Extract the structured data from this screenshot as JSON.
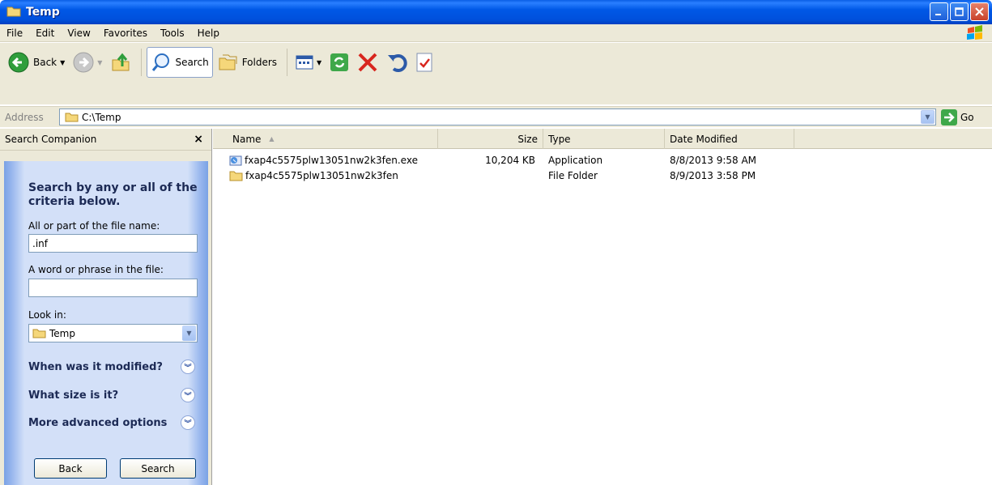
{
  "window": {
    "title": "Temp"
  },
  "menu": [
    "File",
    "Edit",
    "View",
    "Favorites",
    "Tools",
    "Help"
  ],
  "toolbar": {
    "back_label": "Back",
    "search_label": "Search",
    "folders_label": "Folders"
  },
  "address": {
    "label": "Address",
    "path": "C:\\Temp",
    "go_label": "Go"
  },
  "search_pane": {
    "title": "Search Companion",
    "close": "×",
    "heading": "Search by any or all of the criteria below.",
    "filename_label": "All or part of the file name:",
    "filename_value": ".inf",
    "phrase_label": "A word or phrase in the file:",
    "phrase_value": "",
    "lookin_label": "Look in:",
    "lookin_value": "Temp",
    "opt_modified": "When was it modified?",
    "opt_size": "What size is it?",
    "opt_advanced": "More advanced options",
    "back_button": "Back",
    "search_button": "Search"
  },
  "columns": {
    "name": "Name",
    "size": "Size",
    "type": "Type",
    "date": "Date Modified"
  },
  "files": [
    {
      "name": "fxap4c5575plw13051nw2k3fen.exe",
      "size": "10,204 KB",
      "type": "Application",
      "date": "8/8/2013 9:58 AM",
      "icon": "exe-icon"
    },
    {
      "name": "fxap4c5575plw13051nw2k3fen",
      "size": "",
      "type": "File Folder",
      "date": "8/9/2013 3:58 PM",
      "icon": "folder-icon"
    }
  ],
  "colors": {
    "titlebar": "#0058e6",
    "chrome": "#ece9d8",
    "pane_blue": "#d3e0f8",
    "heading": "#1c2a55"
  }
}
